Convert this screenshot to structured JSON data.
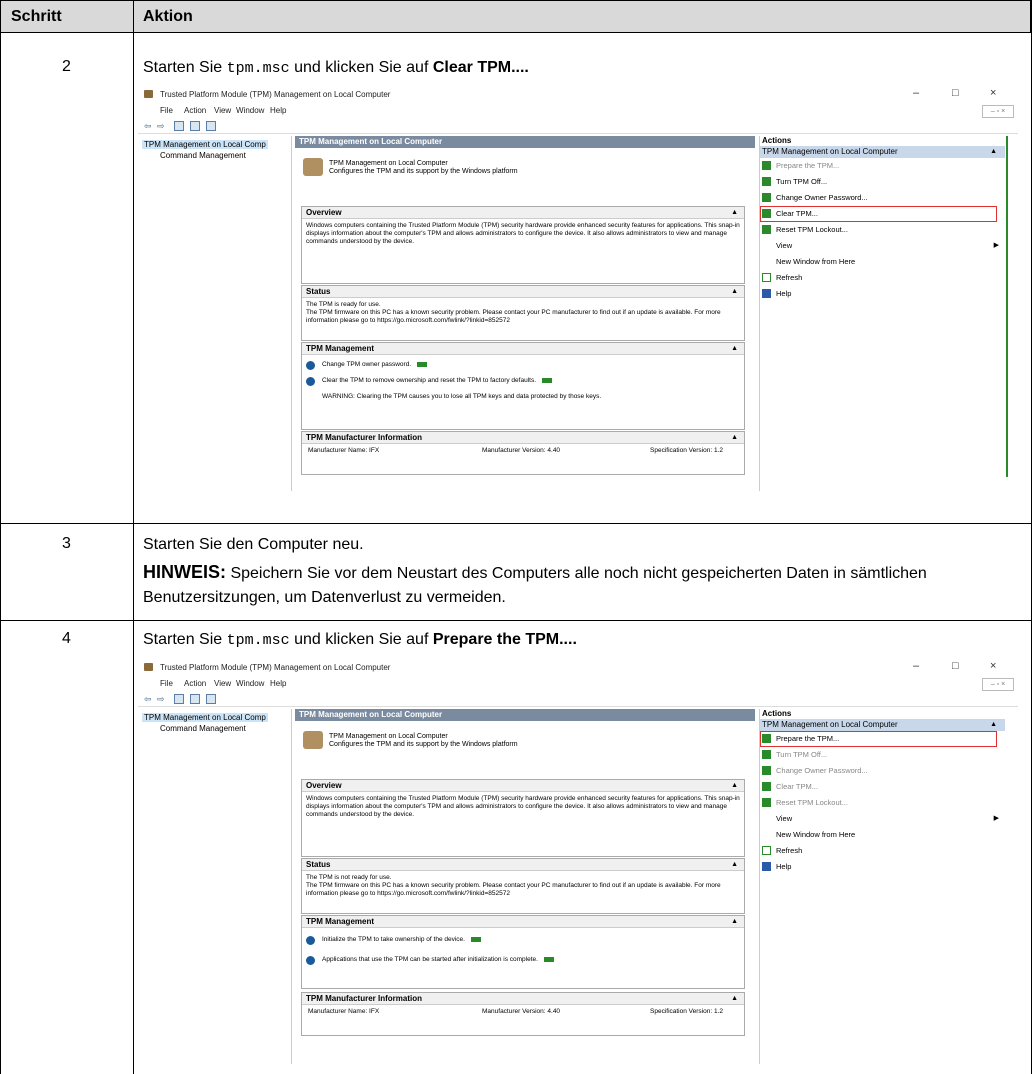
{
  "table": {
    "headers": [
      "Schritt",
      "Aktion"
    ]
  },
  "step2": {
    "number": "2",
    "text_start": "Starten Sie",
    "command": "tpm.msc",
    "text_mid": "und klicken Sie auf",
    "target": "Clear TPM...."
  },
  "step3": {
    "number": "3",
    "text": "Starten Sie den Computer neu.",
    "note_label": "HINWEIS:",
    "note_text": "Speichern Sie vor dem Neustart des Computers alle noch nicht gespeicherten Daten in sämtlichen Benutzersitzungen, um Datenverlust zu vermeiden."
  },
  "step4": {
    "number": "4",
    "text_start": "Starten Sie",
    "command": "tpm.msc",
    "text_mid": "und klicken Sie auf",
    "target": "Prepare the TPM...."
  },
  "mmc": {
    "window_title": "Trusted Platform Module (TPM) Management on Local Computer",
    "menu": [
      "File",
      "Action",
      "View",
      "Window",
      "Help"
    ],
    "tree_root": "TPM Management on Local Comp",
    "tree_child": "Command Management",
    "center_header": "TPM Management on Local Computer",
    "intro_line1": "TPM Management on Local Computer",
    "intro_line2": "Configures the TPM and its support by the Windows platform",
    "overview_title": "Overview",
    "overview_text": "Windows computers containing the Trusted Platform Module (TPM) security hardware provide enhanced security features for applications. This snap-in displays information about the computer's TPM and allows administrators to configure the device. It also allows administrators to view and manage commands understood by the device.",
    "status_title": "Status",
    "tpm_mgmt_title": "TPM Management",
    "mfr_title": "TPM Manufacturer Information",
    "mfr_name": "Manufacturer Name:  IFX",
    "mfr_version": "Manufacturer Version:  4.40",
    "spec_version": "Specification Version:  1.2",
    "actions_title": "Actions",
    "actions_group": "TPM Management on Local Computer"
  },
  "shot1": {
    "status_line1": "The TPM is ready for use.",
    "status_line2": "The TPM firmware on this PC has a known security problem. Please contact your PC manufacturer to find out if an update is available. For more information please go to https://go.microsoft.com/fwlink/?linkid=852572",
    "mgmt_item1": "Change TPM owner password.",
    "mgmt_item2": "Clear the TPM to remove ownership and reset the TPM to factory defaults.",
    "mgmt_warning": "WARNING: Clearing the TPM causes you to lose all TPM keys and data protected by those keys.",
    "actions": [
      "Prepare the TPM...",
      "Turn TPM Off...",
      "Change Owner Password...",
      "Clear TPM...",
      "Reset TPM Lockout...",
      "View",
      "New Window from Here",
      "Refresh",
      "Help"
    ]
  },
  "shot2": {
    "status_line1": "The TPM is not ready for use.",
    "status_line2": "The TPM firmware on this PC has a known security problem. Please contact your PC manufacturer to find out if an update is available. For more information please go to https://go.microsoft.com/fwlink/?linkid=852572",
    "mgmt_item1": "Initialize the TPM to take ownership of the device.",
    "mgmt_item2": "Applications that use the TPM can be started after initialization is complete.",
    "actions": [
      "Prepare the TPM...",
      "Turn TPM Off...",
      "Change Owner Password...",
      "Clear TPM...",
      "Reset TPM Lockout...",
      "View",
      "New Window from Here",
      "Refresh",
      "Help"
    ]
  }
}
